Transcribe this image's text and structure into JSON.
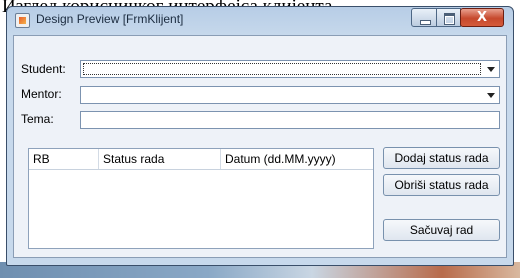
{
  "caption_text": "Изглед корисничког интерфејса клијента",
  "window": {
    "title": "Design Preview [FrmKlijent]",
    "close_glyph": "X"
  },
  "form": {
    "student_label": "Student:",
    "mentor_label": "Mentor:",
    "tema_label": "Tema:",
    "student_value": "",
    "mentor_value": "",
    "tema_value": ""
  },
  "table": {
    "columns": [
      "RB",
      "Status rada",
      "Datum (dd.MM.yyyy)"
    ]
  },
  "buttons": {
    "add": "Dodaj status rada",
    "delete": "Obriši status rada",
    "save": "Sačuvaj rad"
  },
  "icons": [
    "java-cup-icon",
    "minimize-icon",
    "maximize-icon",
    "close-icon",
    "chevron-down-icon"
  ]
}
